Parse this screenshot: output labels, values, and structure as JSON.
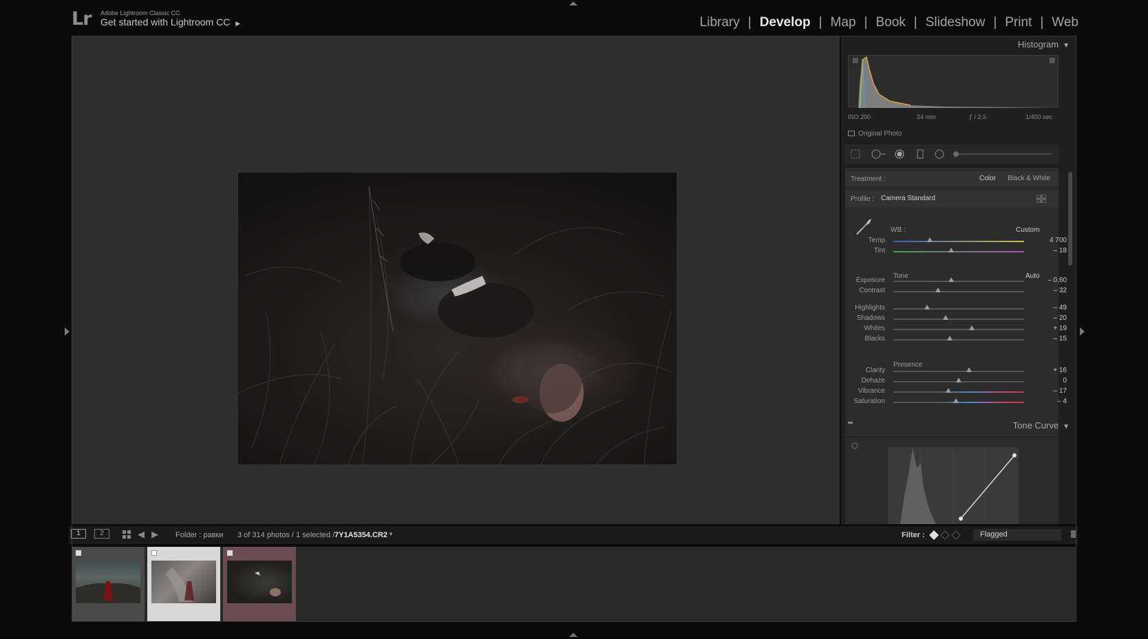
{
  "app": {
    "logo": "Lr",
    "subtitle": "Adobe Lightroom Classic CC",
    "title": "Get started with Lightroom CC"
  },
  "modules": [
    {
      "label": "Library",
      "active": false
    },
    {
      "label": "Develop",
      "active": true
    },
    {
      "label": "Map",
      "active": false
    },
    {
      "label": "Book",
      "active": false
    },
    {
      "label": "Slideshow",
      "active": false
    },
    {
      "label": "Print",
      "active": false
    },
    {
      "label": "Web",
      "active": false
    }
  ],
  "histogram": {
    "title": "Histogram",
    "iso": "ISO 200",
    "focal": "24 mm",
    "aperture": "ƒ / 2,5",
    "shutter": "1/400 sec",
    "original_photo": "Original Photo"
  },
  "basic": {
    "treatment_label": "Treatment :",
    "treatment_color": "Color",
    "treatment_bw": "Black & White",
    "profile_label": "Profile :",
    "profile_value": "Camera Standard",
    "wb_label": "WB :",
    "wb_value": "Custom",
    "tone_label": "Tone",
    "auto_label": "Auto",
    "presence_label": "Presence",
    "sliders": {
      "temp": {
        "label": "Temp",
        "value": "4 700",
        "pos": 0.28
      },
      "tint": {
        "label": "Tint",
        "value": "– 18",
        "pos": 0.44
      },
      "exposure": {
        "label": "Exposure",
        "value": "– 0,60",
        "pos": 0.44
      },
      "contrast": {
        "label": "Contrast",
        "value": "– 32",
        "pos": 0.34
      },
      "highlights": {
        "label": "Highlights",
        "value": "– 49",
        "pos": 0.26
      },
      "shadows": {
        "label": "Shadows",
        "value": "– 20",
        "pos": 0.4
      },
      "whites": {
        "label": "Whites",
        "value": "+ 19",
        "pos": 0.6
      },
      "blacks": {
        "label": "Blacks",
        "value": "– 15",
        "pos": 0.43
      },
      "clarity": {
        "label": "Clarity",
        "value": "+ 16",
        "pos": 0.58
      },
      "dehaze": {
        "label": "Dehaze",
        "value": "0",
        "pos": 0.5
      },
      "vibrance": {
        "label": "Vibrance",
        "value": "– 17",
        "pos": 0.42
      },
      "saturation": {
        "label": "Saturation",
        "value": "– 4",
        "pos": 0.48
      }
    }
  },
  "tone_curve": {
    "title": "Tone Curve"
  },
  "filmbar": {
    "view1": "1",
    "view2": "2",
    "folder": "Folder : равки",
    "count": "3 of 314 photos / 1 selected /",
    "filename": "7Y1A5354.CR2",
    "filter_label": "Filter :",
    "filter_value": "Flagged"
  },
  "colors": {
    "bg": "#0b0b0b",
    "center_bg": "#2f2f2f",
    "panel_bg": "#2c2c2c",
    "accent_selected": "#d8d8d8",
    "thumb3_tint": "#6a4c52"
  }
}
